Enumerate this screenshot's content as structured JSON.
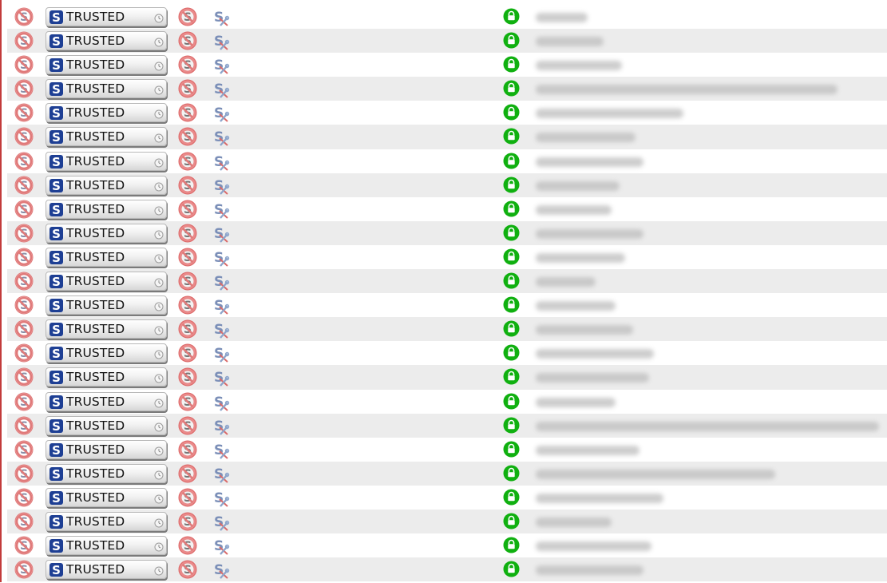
{
  "colors": {
    "ban_red": "#e07a7a",
    "trusted_blue": "#1e3f94",
    "lock_green": "#10b010",
    "stripe": "#ececec"
  },
  "icons": {
    "block": "forbidden-script-icon",
    "trust": "script-s-logo-icon",
    "clock": "clock-icon",
    "tool": "script-settings-icon",
    "secure": "green-lock-icon"
  },
  "trusted_label": "TRUSTED",
  "rows": [
    {
      "status": "TRUSTED",
      "secure": true
    },
    {
      "status": "TRUSTED",
      "secure": true
    },
    {
      "status": "TRUSTED",
      "secure": true
    },
    {
      "status": "TRUSTED",
      "secure": true
    },
    {
      "status": "TRUSTED",
      "secure": true
    },
    {
      "status": "TRUSTED",
      "secure": true
    },
    {
      "status": "TRUSTED",
      "secure": true
    },
    {
      "status": "TRUSTED",
      "secure": true
    },
    {
      "status": "TRUSTED",
      "secure": true
    },
    {
      "status": "TRUSTED",
      "secure": true
    },
    {
      "status": "TRUSTED",
      "secure": true
    },
    {
      "status": "TRUSTED",
      "secure": true
    },
    {
      "status": "TRUSTED",
      "secure": true
    },
    {
      "status": "TRUSTED",
      "secure": true
    },
    {
      "status": "TRUSTED",
      "secure": true
    },
    {
      "status": "TRUSTED",
      "secure": true
    },
    {
      "status": "TRUSTED",
      "secure": true
    },
    {
      "status": "TRUSTED",
      "secure": true
    },
    {
      "status": "TRUSTED",
      "secure": true
    },
    {
      "status": "TRUSTED",
      "secure": true
    },
    {
      "status": "TRUSTED",
      "secure": true
    },
    {
      "status": "TRUSTED",
      "secure": true
    },
    {
      "status": "TRUSTED",
      "secure": true
    },
    {
      "status": "TRUSTED",
      "secure": true
    }
  ]
}
